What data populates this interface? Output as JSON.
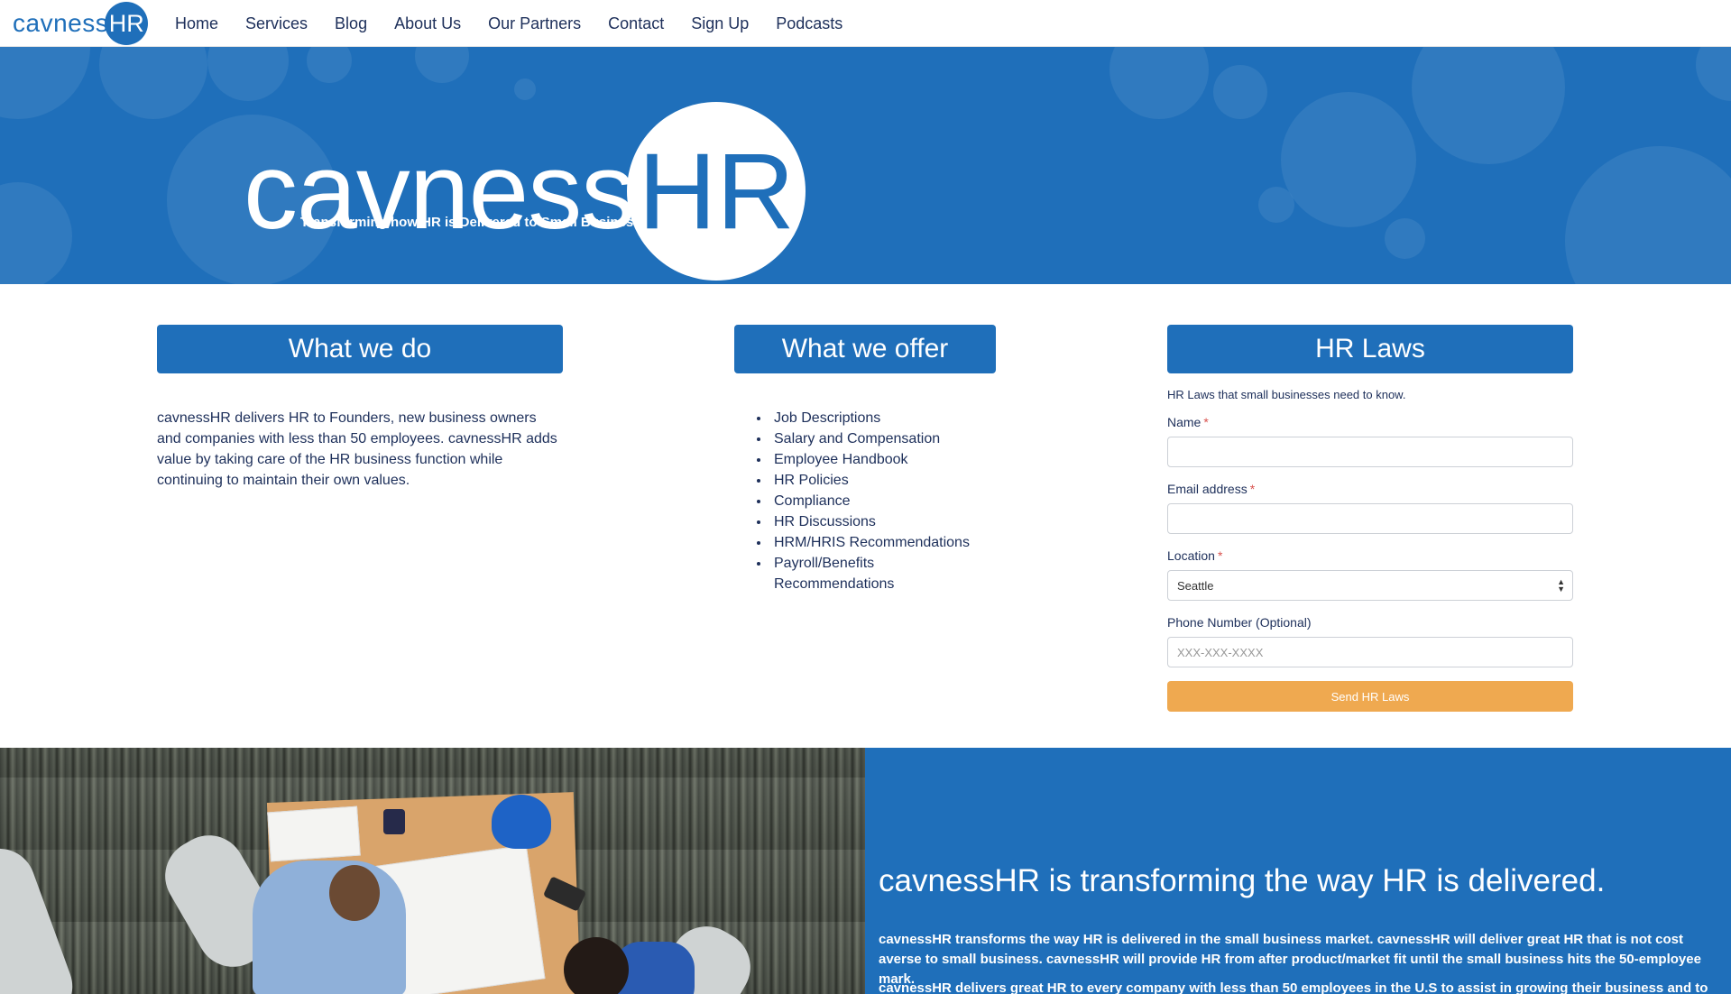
{
  "brand": {
    "word": "cavness",
    "circle": "HR"
  },
  "nav": {
    "items": [
      {
        "label": "Home"
      },
      {
        "label": "Services"
      },
      {
        "label": "Blog"
      },
      {
        "label": "About Us"
      },
      {
        "label": "Our Partners"
      },
      {
        "label": "Contact"
      },
      {
        "label": "Sign Up"
      },
      {
        "label": "Podcasts"
      }
    ]
  },
  "hero": {
    "word": "cavness",
    "circle": "HR",
    "tagline": "Transforming how HR is Delivered to Small Business."
  },
  "what_we_do": {
    "heading": "What we do",
    "body": "cavnessHR delivers HR to Founders, new business owners and companies with less than 50 employees. cavnessHR adds value by taking care of the HR business function while continuing to maintain their own values."
  },
  "what_we_offer": {
    "heading": "What we offer",
    "items": [
      "Job Descriptions",
      "Salary and Compensation",
      "Employee Handbook",
      "HR Policies",
      "Compliance",
      "HR Discussions",
      "HRM/HRIS Recommendations",
      "Payroll/Benefits Recommendations"
    ]
  },
  "hr_laws": {
    "heading": "HR Laws",
    "intro": "HR Laws that small businesses need to know.",
    "name_label": "Name",
    "email_label": "Email address",
    "location_label": "Location",
    "location_value": "Seattle",
    "phone_label": "Phone Number (Optional)",
    "phone_placeholder": "XXX-XXX-XXXX",
    "required_mark": "*",
    "submit_label": "Send HR Laws"
  },
  "promo": {
    "heading": "cavnessHR is transforming the way HR is delivered.",
    "paragraph1": "cavnessHR transforms the way HR is delivered in the small business market. cavnessHR will deliver great HR that is not cost averse to small business. cavnessHR will provide HR from after product/market fit until the small business hits the 50-employee mark.",
    "paragraph2": "cavnessHR delivers great HR to every company with less than 50 employees in the U.S to assist in growing their business and to assist"
  },
  "colors": {
    "brand_blue": "#1f6fba",
    "nav_text": "#1d2f5a",
    "submit_orange": "#efa950",
    "required_red": "#d9534f"
  }
}
